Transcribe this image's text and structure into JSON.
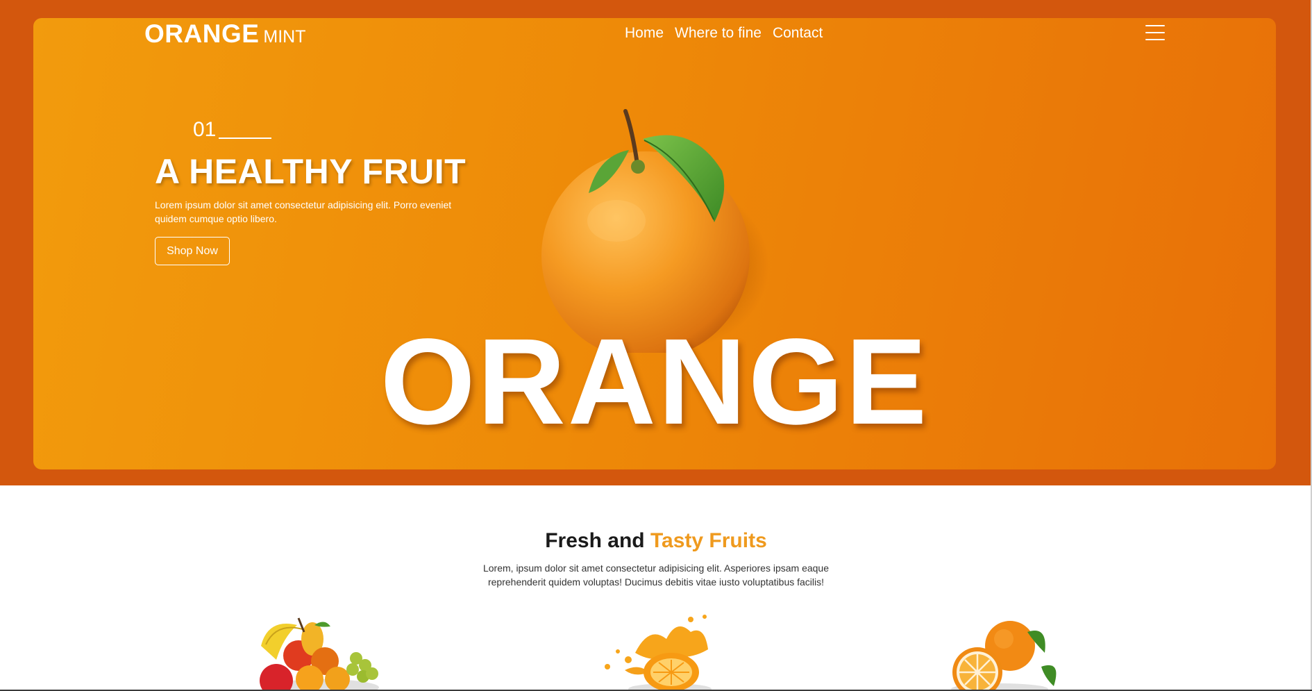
{
  "brand": {
    "name_main": "ORANGE",
    "name_sub": "MINT"
  },
  "nav": {
    "items": [
      {
        "label": "Home"
      },
      {
        "label": "Where to fine"
      },
      {
        "label": "Contact"
      }
    ]
  },
  "hero": {
    "slide_number": "01",
    "headline": "A HEALTHY FRUIT",
    "lead": "Lorem ipsum dolor sit amet consectetur adipisicing elit. Porro eveniet quidem cumque optio libero.",
    "cta_label": "Shop Now",
    "big_word": "ORANGE"
  },
  "section": {
    "title_plain": "Fresh and",
    "title_accent": "Tasty Fruits",
    "description": "Lorem, ipsum dolor sit amet consectetur adipisicing elit. Asperiores ipsam eaque reprehenderit quidem voluptas! Ducimus debitis vitae iusto voluptatibus facilis!"
  },
  "colors": {
    "band": "#d3570d",
    "card_start": "#f29b0d",
    "card_end": "#e87008",
    "accent_text": "#ef9a1e",
    "text_dark": "#1a1a1a"
  },
  "icons": {
    "menu": "hamburger-icon",
    "hero_image": "orange-fruit-image",
    "thumbs": [
      "mixed-fruits-image",
      "orange-juice-splash-image",
      "orange-slices-image"
    ]
  }
}
